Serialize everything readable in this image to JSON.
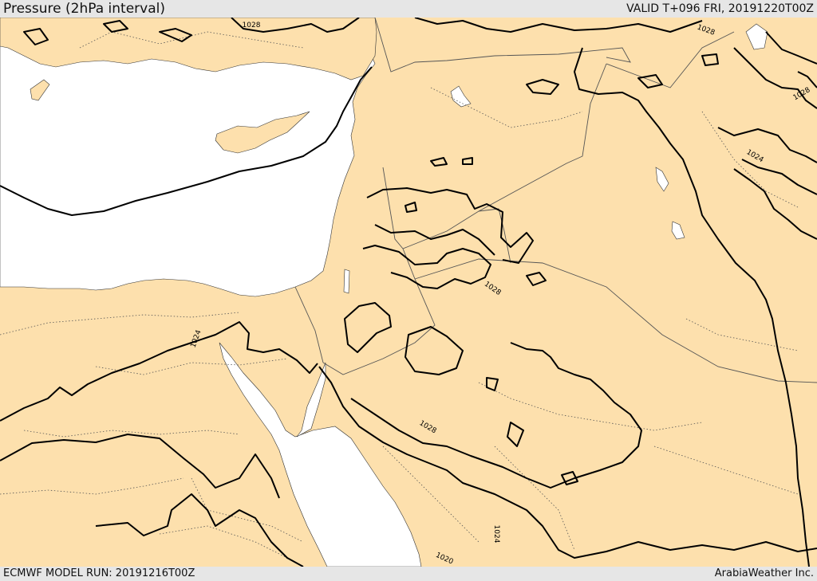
{
  "header": {
    "title": "Pressure (2hPa interval)",
    "valid": "VALID T+096 FRI, 20191220T00Z"
  },
  "footer": {
    "run": "ECMWF MODEL RUN: 20191216T00Z",
    "credit": "ArabiaWeather Inc."
  },
  "colors": {
    "land": "#fde0ad",
    "sea": "#ffffff",
    "isobar": "#000000",
    "border": "#555555"
  },
  "contour_labels": {
    "l1": "1028",
    "l2": "1028",
    "l3": "1028",
    "l4": "1024",
    "l5": "1024",
    "l6": "1028",
    "l7": "1028",
    "l8": "1024",
    "l9": "1020"
  }
}
